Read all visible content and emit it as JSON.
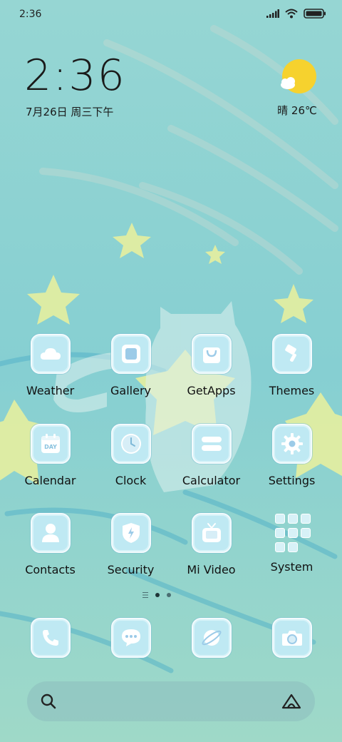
{
  "status_bar": {
    "time": "2:36"
  },
  "clock_widget": {
    "time": "2:36",
    "date": "7月26日 周三下午"
  },
  "weather_widget": {
    "label": "晴 26℃"
  },
  "apps": [
    {
      "label": "Weather",
      "icon": "cloud-icon"
    },
    {
      "label": "Gallery",
      "icon": "image-icon"
    },
    {
      "label": "GetApps",
      "icon": "shopping-bag-icon"
    },
    {
      "label": "Themes",
      "icon": "paint-brush-icon"
    },
    {
      "label": "Calendar",
      "icon": "calendar-icon"
    },
    {
      "label": "Clock",
      "icon": "clock-icon"
    },
    {
      "label": "Calculator",
      "icon": "calculator-icon"
    },
    {
      "label": "Settings",
      "icon": "gear-icon"
    },
    {
      "label": "Contacts",
      "icon": "person-icon"
    },
    {
      "label": "Security",
      "icon": "shield-icon"
    },
    {
      "label": "Mi Video",
      "icon": "tv-icon"
    },
    {
      "label": "System",
      "icon": "folder-grid-icon"
    }
  ],
  "calendar_icon_text": "DAY",
  "dock": [
    {
      "name": "phone",
      "icon": "phone-icon"
    },
    {
      "name": "messages",
      "icon": "chat-bubble-icon"
    },
    {
      "name": "browser",
      "icon": "planet-icon"
    },
    {
      "name": "camera",
      "icon": "camera-icon"
    }
  ],
  "colors": {
    "icon_fill": "#bfe9f3",
    "wallpaper_base": "#8fd3d3"
  }
}
